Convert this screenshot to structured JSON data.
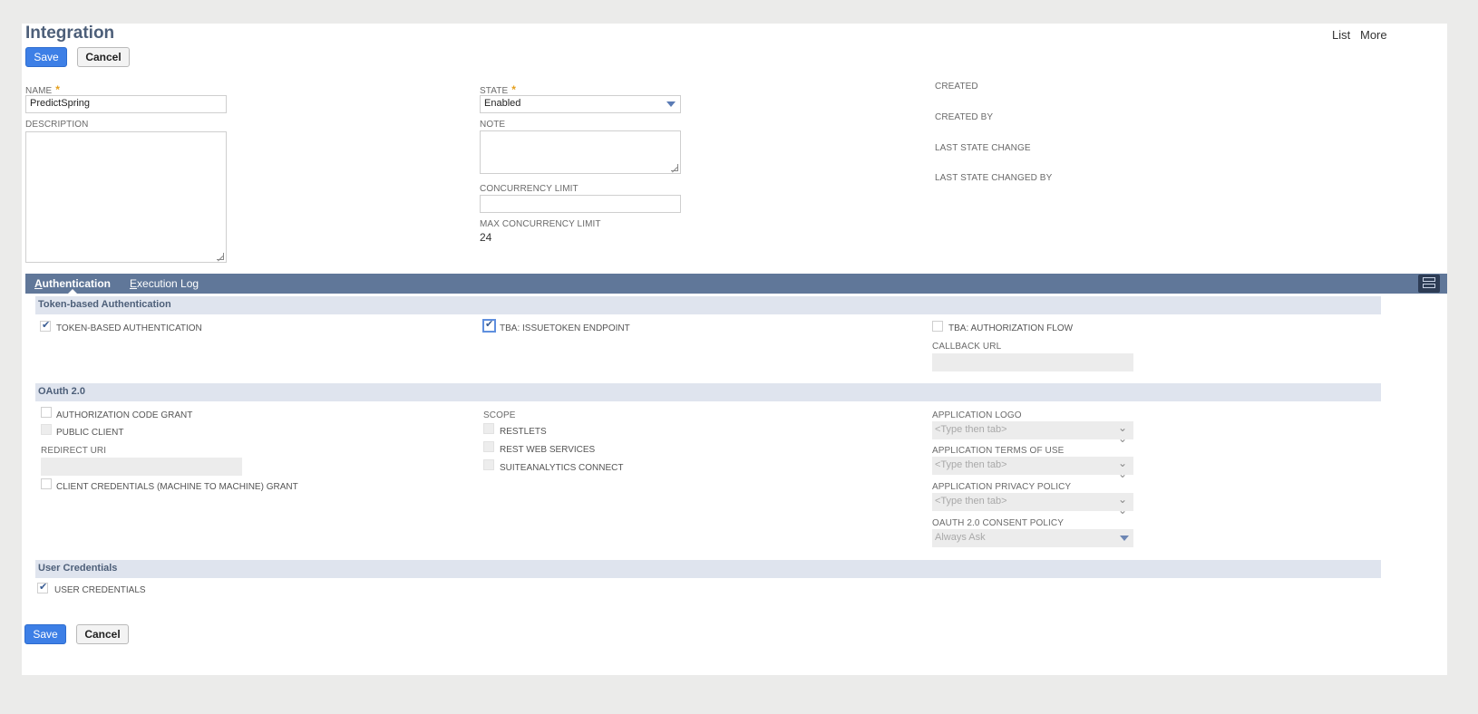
{
  "header": {
    "title": "Integration",
    "links": {
      "list": "List",
      "more": "More"
    }
  },
  "buttons": {
    "save": "Save",
    "cancel": "Cancel"
  },
  "form": {
    "name": {
      "label": "NAME",
      "value": "PredictSpring"
    },
    "description": {
      "label": "DESCRIPTION"
    },
    "state": {
      "label": "STATE",
      "value": "Enabled"
    },
    "note": {
      "label": "NOTE"
    },
    "concurrency_limit": {
      "label": "CONCURRENCY LIMIT",
      "value": ""
    },
    "max_concurrency_limit": {
      "label": "MAX CONCURRENCY LIMIT",
      "value": "24"
    },
    "info": {
      "created": "CREATED",
      "created_by": "CREATED BY",
      "last_state_change": "LAST STATE CHANGE",
      "last_state_changed_by": "LAST STATE CHANGED BY"
    }
  },
  "tabs": [
    {
      "first": "A",
      "rest": "uthentication"
    },
    {
      "first": "E",
      "rest": "xecution Log"
    }
  ],
  "tba": {
    "heading": "Token-based Authentication",
    "token_based_auth": {
      "label": "TOKEN-BASED AUTHENTICATION",
      "checked": true
    },
    "issuetoken_endpoint": {
      "label": "TBA: ISSUETOKEN ENDPOINT",
      "checked": true
    },
    "authorization_flow": {
      "label": "TBA: AUTHORIZATION FLOW",
      "checked": false
    },
    "callback_url": {
      "label": "CALLBACK URL"
    }
  },
  "oauth": {
    "heading": "OAuth 2.0",
    "auth_code_grant": {
      "label": "AUTHORIZATION CODE GRANT",
      "checked": false
    },
    "public_client": {
      "label": "PUBLIC CLIENT",
      "checked": false
    },
    "redirect_uri": {
      "label": "REDIRECT URI"
    },
    "client_credentials": {
      "label": "CLIENT CREDENTIALS (MACHINE TO MACHINE) GRANT",
      "checked": false
    },
    "scope": {
      "label": "SCOPE",
      "restlets": "RESTLETS",
      "rest_web_services": "REST WEB SERVICES",
      "suiteanalytics_connect": "SUITEANALYTICS CONNECT"
    },
    "app_logo": {
      "label": "APPLICATION LOGO",
      "placeholder": "<Type then tab>"
    },
    "app_terms": {
      "label": "APPLICATION TERMS OF USE",
      "placeholder": "<Type then tab>"
    },
    "app_privacy": {
      "label": "APPLICATION PRIVACY POLICY",
      "placeholder": "<Type then tab>"
    },
    "consent_policy": {
      "label": "OAUTH 2.0 CONSENT POLICY",
      "value": "Always Ask"
    }
  },
  "user_credentials": {
    "heading": "User Credentials",
    "checkbox": {
      "label": "USER CREDENTIALS",
      "checked": true
    }
  },
  "colors": {
    "accent": "#3d7fe6",
    "tabbar": "#607799",
    "section": "#dfe4ee",
    "title": "#4d5f79"
  }
}
